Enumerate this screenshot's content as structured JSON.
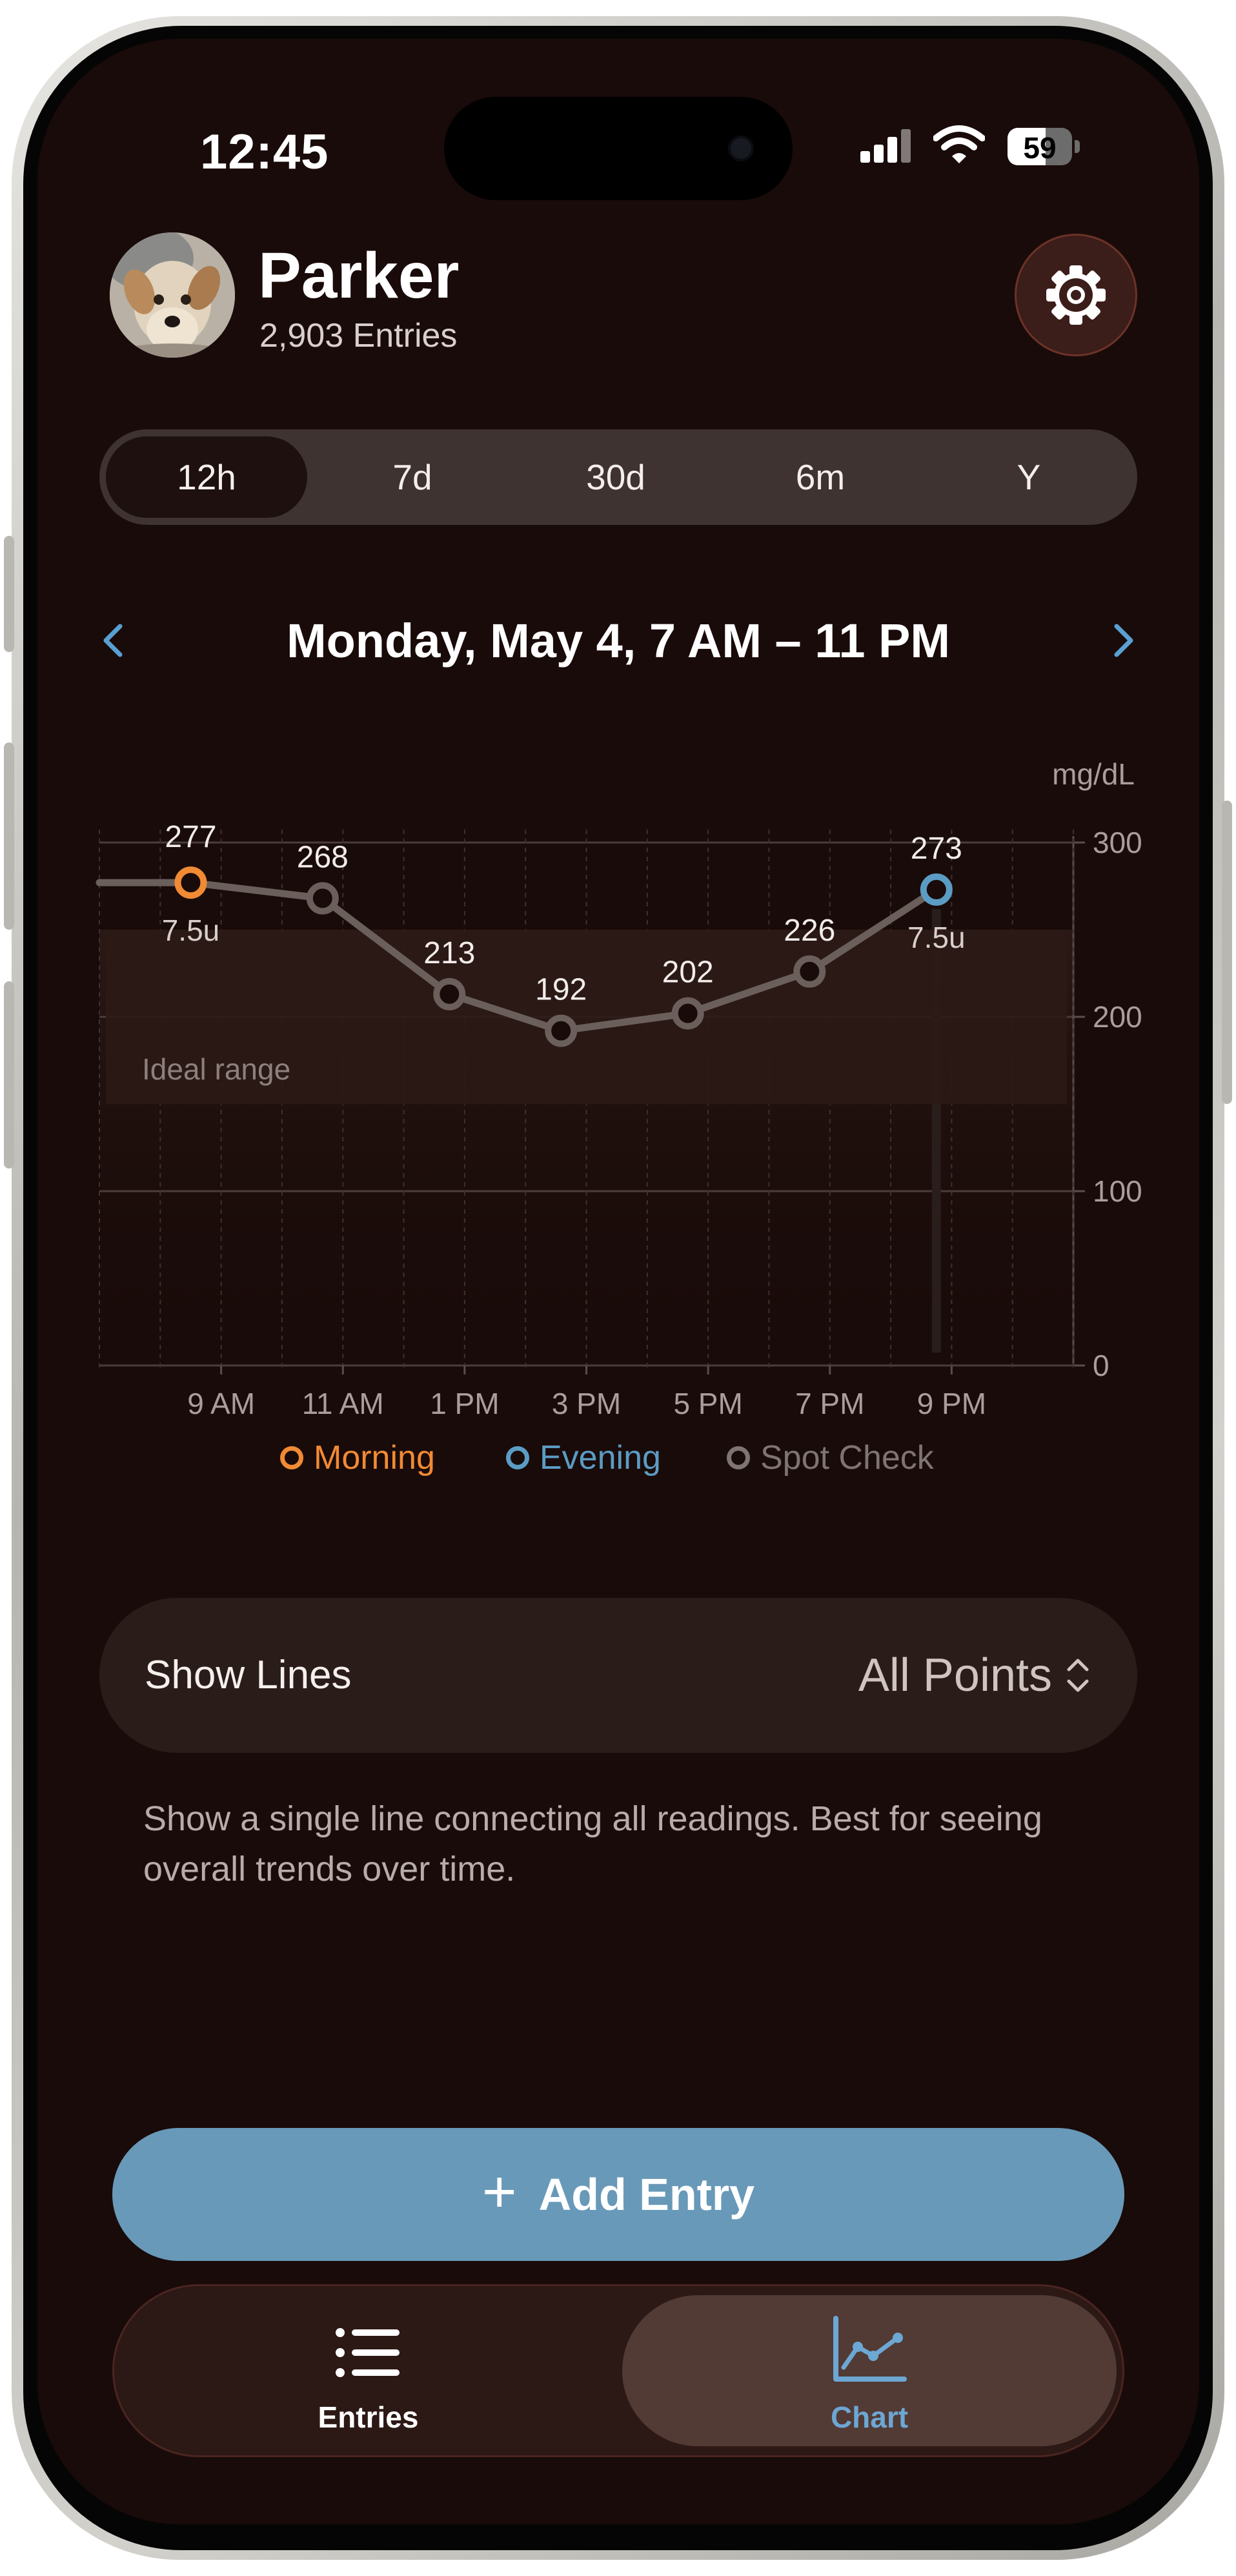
{
  "status": {
    "time": "12:45",
    "battery": "59"
  },
  "profile": {
    "name": "Parker",
    "entries": "2,903 Entries"
  },
  "ranges": [
    {
      "label": "12h",
      "selected": true
    },
    {
      "label": "7d",
      "selected": false
    },
    {
      "label": "30d",
      "selected": false
    },
    {
      "label": "6m",
      "selected": false
    },
    {
      "label": "Y",
      "selected": false
    }
  ],
  "date_title": "Monday, May 4, 7 AM – 11 PM",
  "chart_data": {
    "type": "line",
    "yunit": "mg/dL",
    "ylim": [
      0,
      300
    ],
    "yticks": [
      0,
      100,
      200,
      300
    ],
    "x_tick_labels": [
      "9 AM",
      "11 AM",
      "1 PM",
      "3 PM",
      "5 PM",
      "7 PM",
      "9 PM"
    ],
    "ideal_range": {
      "label": "Ideal range",
      "low": 150,
      "high": 250
    },
    "series": [
      {
        "name": "All Points",
        "points": [
          {
            "x": "8:30 AM",
            "y": 277,
            "type": "Morning",
            "dose": "7.5u"
          },
          {
            "x": "10:40 AM",
            "y": 268,
            "type": "Spot Check",
            "dose": ""
          },
          {
            "x": "12:45 PM",
            "y": 213,
            "type": "Spot Check",
            "dose": ""
          },
          {
            "x": "2:35 PM",
            "y": 192,
            "type": "Spot Check",
            "dose": ""
          },
          {
            "x": "4:40 PM",
            "y": 202,
            "type": "Spot Check",
            "dose": ""
          },
          {
            "x": "6:40 PM",
            "y": 226,
            "type": "Spot Check",
            "dose": ""
          },
          {
            "x": "8:45 PM",
            "y": 273,
            "type": "Evening",
            "dose": "7.5u"
          }
        ]
      }
    ],
    "legend": [
      {
        "name": "Morning",
        "color": "#f18a35"
      },
      {
        "name": "Evening",
        "color": "#5b9cc4"
      },
      {
        "name": "Spot Check",
        "color": "#7e7472"
      }
    ]
  },
  "settings": {
    "show_lines_label": "Show Lines",
    "show_lines_value": "All Points",
    "description": "Show a single line connecting all readings. Best for seeing overall trends over time."
  },
  "add_button": {
    "plus": "+",
    "label": "Add Entry"
  },
  "tabs": [
    {
      "label": "Entries",
      "icon": "list-icon",
      "selected": false
    },
    {
      "label": "Chart",
      "icon": "chart-icon",
      "selected": true
    }
  ],
  "colors": {
    "background": "#190b09",
    "accent": "#6899b8",
    "morning": "#f18a35",
    "evening": "#5b9cc4",
    "spot_check": "#7e7472"
  }
}
